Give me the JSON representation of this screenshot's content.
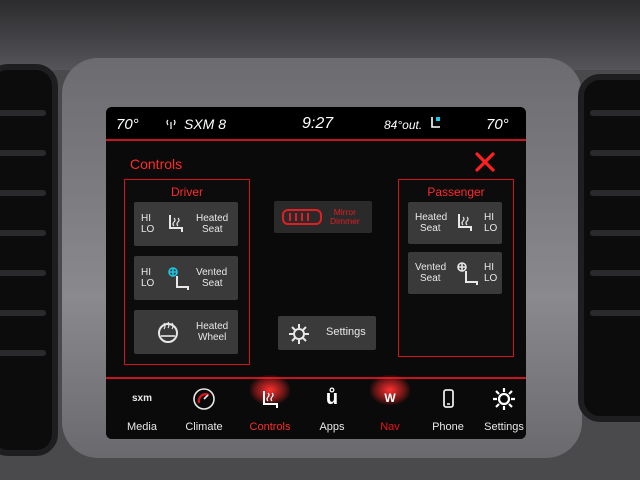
{
  "status_bar": {
    "left_temp": "70°",
    "radio": "SXM 8",
    "time": "9:27",
    "outside_temp": "84°out.",
    "right_temp": "70°"
  },
  "panel": {
    "title": "Controls"
  },
  "driver": {
    "title": "Driver",
    "heated_seat": {
      "hi": "HI",
      "lo": "LO",
      "label_1": "Heated",
      "label_2": "Seat"
    },
    "vented_seat": {
      "hi": "HI",
      "lo": "LO",
      "label_1": "Vented",
      "label_2": "Seat"
    },
    "heated_wheel": {
      "label_1": "Heated",
      "label_2": "Wheel"
    }
  },
  "mirror_dimmer": {
    "label_1": "Mirror",
    "label_2": "Dimmer"
  },
  "settings": {
    "label": "Settings"
  },
  "passenger": {
    "title": "Passenger",
    "heated_seat": {
      "hi": "HI",
      "lo": "LO",
      "label_1": "Heated",
      "label_2": "Seat"
    },
    "vented_seat": {
      "hi": "HI",
      "lo": "LO",
      "label_1": "Vented",
      "label_2": "Seat"
    }
  },
  "nav": {
    "items": [
      {
        "label": "Media",
        "icon": "sxm-icon",
        "text": "sxm"
      },
      {
        "label": "Climate",
        "icon": "climate-icon"
      },
      {
        "label": "Controls",
        "icon": "controls-icon"
      },
      {
        "label": "Apps",
        "icon": "apps-icon",
        "text": "ů"
      },
      {
        "label": "Nav",
        "icon": "nav-icon",
        "text": "W"
      },
      {
        "label": "Phone",
        "icon": "phone-icon"
      },
      {
        "label": "Settings",
        "icon": "gear-icon"
      }
    ],
    "active": "Controls"
  },
  "colors": {
    "accent": "#d4141c",
    "button": "#3a3a3a",
    "screen": "#0a0a0a"
  }
}
